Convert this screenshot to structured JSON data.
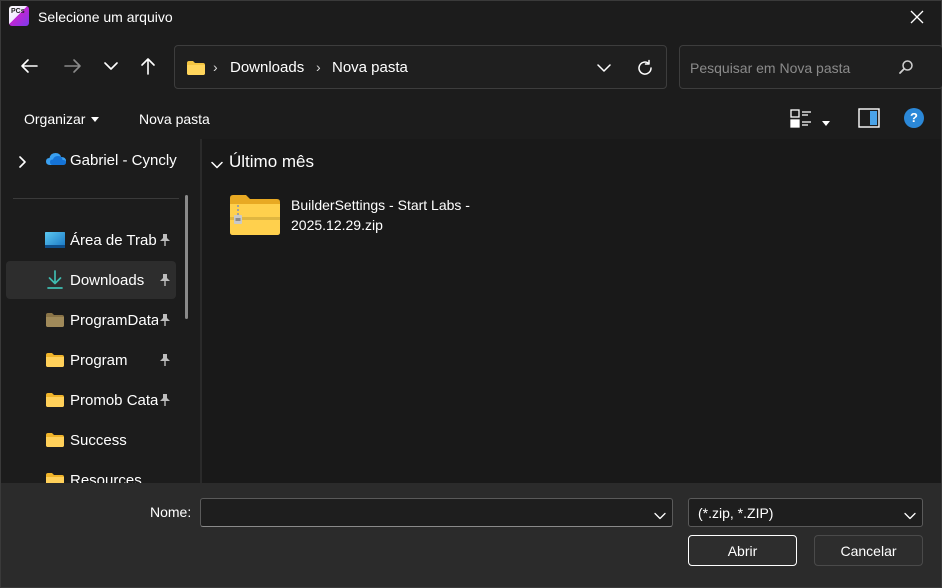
{
  "window": {
    "title": "Selecione um arquivo",
    "app_icon": "pcs-app-icon",
    "app_icon_text": "PCs"
  },
  "nav": {
    "back_icon": "arrow-left-icon",
    "forward_icon": "arrow-right-icon",
    "recent_icon": "chevron-down-icon",
    "up_icon": "arrow-up-icon"
  },
  "address": {
    "crumbs": [
      "Downloads",
      "Nova pasta"
    ],
    "separator": "›"
  },
  "search": {
    "placeholder": "Pesquisar em Nova pasta"
  },
  "toolbar": {
    "organize_label": "Organizar",
    "new_folder_label": "Nova pasta"
  },
  "sidebar": {
    "items": [
      {
        "label": "Gabriel - Cyncly",
        "icon": "onedrive-cloud-icon",
        "pinned": false
      },
      {
        "label": "Área de Trab",
        "icon": "desktop-icon",
        "pinned": true
      },
      {
        "label": "Downloads",
        "icon": "download-arrow-icon",
        "pinned": true,
        "active": true
      },
      {
        "label": "ProgramData",
        "icon": "folder-icon",
        "pinned": true
      },
      {
        "label": "Program",
        "icon": "folder-icon",
        "pinned": true
      },
      {
        "label": "Promob Cata",
        "icon": "folder-icon",
        "pinned": true
      },
      {
        "label": "Success",
        "icon": "folder-icon",
        "pinned": false
      },
      {
        "label": "Resources",
        "icon": "folder-icon",
        "pinned": false
      }
    ]
  },
  "main": {
    "group_title": "Último mês",
    "files": [
      {
        "name": "BuilderSettings - Start Labs - 2025.12.29.zip",
        "icon": "zip-folder-icon"
      }
    ]
  },
  "footer": {
    "name_label": "Nome:",
    "name_value": "",
    "filetype": "(*.zip, *.ZIP)",
    "open_label": "Abrir",
    "cancel_label": "Cancelar"
  },
  "colors": {
    "accent": "#2b88d8",
    "folder": "#f4c542",
    "background": "#1c1c1c",
    "footer": "#2b2b2b"
  }
}
